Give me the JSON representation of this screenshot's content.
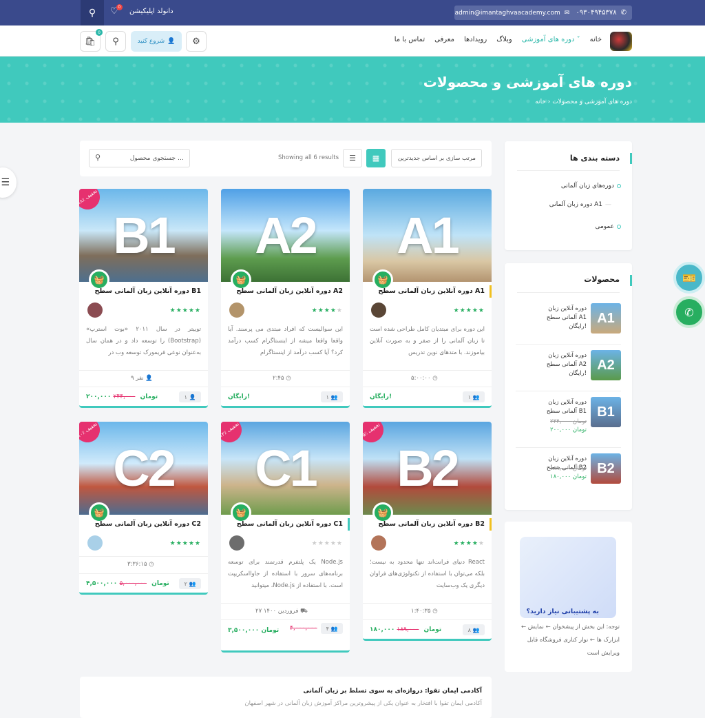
{
  "topbar": {
    "phone": "۰۹۳۰۴۹۴۵۳۷۸",
    "email": "admin@imantaghvaacademy.com",
    "app_download": "دانولد اپلیکیشن",
    "heart_count": "0"
  },
  "nav": {
    "menu": [
      "خانه",
      "دوره های آموزشی",
      "وبلاگ",
      "رویدادها",
      "معرفی",
      "تماس با ما"
    ],
    "start_label": "شروع کنید",
    "cart_count": "0"
  },
  "hero": {
    "title": "دوره های آموزشی و محصولات",
    "breadcrumb_home": "خانه",
    "breadcrumb_current": "دوره های آموزشی و محصولات"
  },
  "toolbar": {
    "sort_label": "مرتب سازی بر اساس جدیدترین",
    "showing": "Showing all 6 results",
    "search_placeholder": "جستجوی محصول …"
  },
  "categories": {
    "title": "دسته بندی ها",
    "items": [
      "دوره‌های زبان آلمانی",
      "دوره زبان آلمانی A1",
      "عمومی"
    ]
  },
  "products": {
    "title": "محصولات",
    "items": [
      {
        "thumb": "A1",
        "title": "دوره آنلاین زبان آلمانی سطح A1 رایگان!",
        "old": "",
        "price": ""
      },
      {
        "thumb": "A2",
        "title": "دوره آنلاین زبان آلمانی سطح A2 رایگان!",
        "old": "",
        "price": ""
      },
      {
        "thumb": "B1",
        "title": "دوره آنلاین زبان آلمانی سطح B1",
        "old": "۲۴۴,۰۰۰ تومان",
        "price": "۲۰۰,۰۰۰ تومان"
      },
      {
        "thumb": "B2",
        "title": "دوره آنلاین زبان آلمانی سطح B2",
        "old": "۱۸۹,۰۰۰ تومان",
        "price": "۱۸۰,۰۰۰ تومان"
      }
    ]
  },
  "courses": [
    {
      "level": "A1",
      "badge": "",
      "title": "دوره آنلاین زبان آلمانی سطح A1",
      "desc": "این دوره برای مبتدیان کامل طراحی شده است تا زبان آلمانی را از صفر و به صورت آنلاین بیاموزند. با متدهای نوین تدریس",
      "meta": "۵:۰۰:۰۰",
      "price": "رایگان!",
      "old": "",
      "students": "۱"
    },
    {
      "level": "A2",
      "badge": "",
      "title": "دوره آنلاین زبان آلمانی سطح A2",
      "desc": "این سوالیست که افراد مبتدی می پرسند. آیا واقعا واقعا میشه از اینستاگرام کسب درآمد کرد؟ آیا کسب درآمد از اینستاگرام",
      "meta": "۲:۴۵",
      "price": "رایگان!",
      "old": "",
      "students": "۱"
    },
    {
      "level": "B1",
      "badge": "۱۸٪ تخفیف",
      "title": "دوره آنلاین زبان آلمانی سطح B1",
      "desc": "توییتر در سال ۲۰۱۱ «بوت استرپ» (Bootstrap) را توسعه داد و در همان سال به‌عنوان نوعی فریمورک توسعه وب در",
      "meta": "۹ نفر",
      "price": "۲۰۰,۰۰۰ تومان",
      "old": "۲۴۴,۰۰۰",
      "students": "۱"
    },
    {
      "level": "B2",
      "badge": "۵٪ تخفیف",
      "title": "دوره آنلاین زبان آلمانی سطح B2",
      "desc": "React دنیای فرانت‌اند تنها محدود به نیست؛ بلکه می‌توان با استفاده از تکنولوژی‌های فراوان دیگری یک وب‌سایت",
      "meta": "۱:۴۰:۳۵",
      "price": "۱۸۰,۰۰۰ تومان",
      "old": "۱۸۹,۰۰۰",
      "students": "۸"
    },
    {
      "level": "C1",
      "badge": "۱۳٪ تخفیف",
      "title": "دوره آنلاین زبان آلمانی سطح C1",
      "desc": "Node.js یک پلتفرم قدرتمند برای توسعه برنامه‌های سرور با استفاده از جاوااسکریپت است. با استفاده از Node.js، میتوانید",
      "meta": "۲۷ فروردین ۱۴۰۰",
      "price": "۳,۵۰۰,۰۰۰ تومان",
      "old": "۴,۰۰۰,۰۰۰",
      "students": "۴"
    },
    {
      "level": "C2",
      "badge": "۱۰٪ تخفیف",
      "title": "دوره آنلاین زبان آلمانی سطح C2",
      "desc": "",
      "meta": "۳:۳۶:۱۵",
      "price": "۴,۵۰۰,۰۰۰ تومان",
      "old": "۵,۰۰۰,۰۰۰",
      "students": "۲"
    }
  ],
  "support": {
    "title": "به پشتیبانی نیاز دارید؟",
    "text": "توجه: این بخش از پیشخوان ← نمایش ← ابزارک ها ← نوار کناری فروشگاه قابل ویرایش است"
  },
  "bottom": {
    "title": "آکادمی ایمان تقوا: دروازه‌ای به سوی تسلط بر زبان آلمانی",
    "desc": "آکادمی ایمان تقوا با افتخار به عنوان یکی از پیشروترین مراکز آموزش زبان آلمانی در شهر اصفهان"
  },
  "colors": {
    "accent": "#40c9bd",
    "topbar": "#3a4a8c",
    "green": "#27ae60",
    "pink": "#e6316f"
  }
}
